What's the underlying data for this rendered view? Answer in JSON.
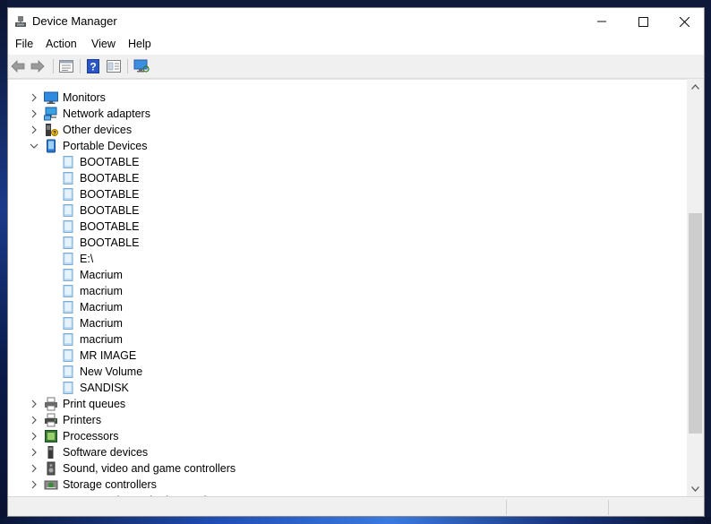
{
  "window": {
    "title": "Device Manager",
    "title_icon": "device-manager-icon"
  },
  "caption_buttons": {
    "minimize": "minimize-icon",
    "maximize": "maximize-icon",
    "close": "close-icon"
  },
  "menu": [
    "File",
    "Action",
    "View",
    "Help"
  ],
  "toolbar": [
    "back-arrow-icon",
    "forward-arrow-icon",
    "properties-icon",
    "help-icon",
    "view-icon",
    "scan-monitor-icon"
  ],
  "tree": [
    {
      "label": "Monitors",
      "icon": "monitor-icon",
      "level": 1,
      "expander": "collapsed"
    },
    {
      "label": "Network adapters",
      "icon": "network-adapter-icon",
      "level": 1,
      "expander": "collapsed"
    },
    {
      "label": "Other devices",
      "icon": "other-devices-icon",
      "level": 1,
      "expander": "collapsed"
    },
    {
      "label": "Portable Devices",
      "icon": "portable-devices-icon",
      "level": 1,
      "expander": "expanded"
    },
    {
      "label": "BOOTABLE",
      "icon": "portable-device-icon",
      "level": 2,
      "expander": "none"
    },
    {
      "label": "BOOTABLE",
      "icon": "portable-device-icon",
      "level": 2,
      "expander": "none"
    },
    {
      "label": "BOOTABLE",
      "icon": "portable-device-icon",
      "level": 2,
      "expander": "none"
    },
    {
      "label": "BOOTABLE",
      "icon": "portable-device-icon",
      "level": 2,
      "expander": "none"
    },
    {
      "label": "BOOTABLE",
      "icon": "portable-device-icon",
      "level": 2,
      "expander": "none"
    },
    {
      "label": "BOOTABLE",
      "icon": "portable-device-icon",
      "level": 2,
      "expander": "none"
    },
    {
      "label": "E:\\",
      "icon": "portable-device-icon",
      "level": 2,
      "expander": "none"
    },
    {
      "label": "Macrium",
      "icon": "portable-device-icon",
      "level": 2,
      "expander": "none"
    },
    {
      "label": "macrium",
      "icon": "portable-device-icon",
      "level": 2,
      "expander": "none"
    },
    {
      "label": "Macrium",
      "icon": "portable-device-icon",
      "level": 2,
      "expander": "none"
    },
    {
      "label": "Macrium",
      "icon": "portable-device-icon",
      "level": 2,
      "expander": "none"
    },
    {
      "label": "macrium",
      "icon": "portable-device-icon",
      "level": 2,
      "expander": "none"
    },
    {
      "label": "MR IMAGE",
      "icon": "portable-device-icon",
      "level": 2,
      "expander": "none"
    },
    {
      "label": "New Volume",
      "icon": "portable-device-icon",
      "level": 2,
      "expander": "none"
    },
    {
      "label": "SANDISK",
      "icon": "portable-device-icon",
      "level": 2,
      "expander": "none"
    },
    {
      "label": "Print queues",
      "icon": "print-queue-icon",
      "level": 1,
      "expander": "collapsed"
    },
    {
      "label": "Printers",
      "icon": "printer-icon",
      "level": 1,
      "expander": "collapsed"
    },
    {
      "label": "Processors",
      "icon": "processor-icon",
      "level": 1,
      "expander": "collapsed"
    },
    {
      "label": "Software devices",
      "icon": "software-device-icon",
      "level": 1,
      "expander": "collapsed"
    },
    {
      "label": "Sound, video and game controllers",
      "icon": "speaker-icon",
      "level": 1,
      "expander": "collapsed"
    },
    {
      "label": "Storage controllers",
      "icon": "storage-controller-icon",
      "level": 1,
      "expander": "collapsed"
    },
    {
      "label": "Storage volume shadow copies",
      "icon": "storage-volume-icon",
      "level": 1,
      "expander": "collapsed"
    }
  ],
  "colors": {
    "tree_bg": "#ffffff",
    "window_bg": "#f0f0f0",
    "device_blue": "#4a8fd9",
    "scroll_thumb": "#cdcdcd"
  }
}
